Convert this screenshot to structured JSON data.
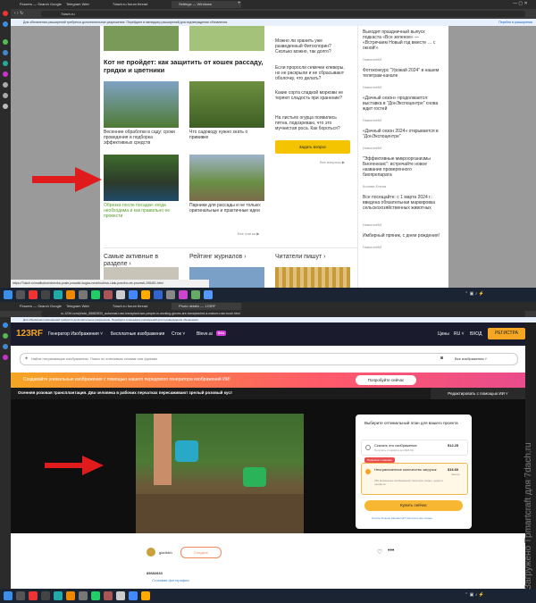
{
  "browser1": {
    "tabs": [
      "Flowers — Search Google",
      "Telegram Web",
      "7dach.ru forum thread",
      "Settings — Windows"
    ],
    "url": "7dach.ru",
    "notice": "Для обновления расширений требуется дополнительное разрешение. Перейдите в менеджер расширений для подтверждения обновления.",
    "notice_btn": "Перейти в расширения"
  },
  "page1": {
    "section_title": "Кот не пройдет: как защитить от кошек рассаду, грядки и цветники",
    "cards": [
      "Весенние обработки в саду: сроки проведения и подборка эффективных средств",
      "Что садоводу нужно знать о прививке",
      "Обрезка после посадки: когда необходима и как правильно ее провести",
      "Парники для рассады и не только: оригинальные и практичные идеи"
    ],
    "all_articles": "Все статьи ▶",
    "qa": [
      "Можно ли хранить уже разведенный Фитоспорин? Сколько можно, так долго?",
      "Если проросли семечки клеверы, но не раскрыли и не сбрасывают оболочку, что делать?",
      "Какие сорта сладкой моркови не теряют сладость при хранении?",
      "На листьях огурца появились пятна, подозреваю, что это мучнистая роса. Как бороться?"
    ],
    "ask_btn": "Задать вопрос",
    "all_questions": "Все вопросы ▶",
    "news": [
      {
        "t": "Выходит праздничный выпуск подкаста «Все зеленое» — «Встречаем Новый год вместе … с окной!»",
        "s": "НовостиНИ"
      },
      {
        "t": "Фотоконкурс \"Урожай 2024\" в нашем телеграм-канале",
        "s": "НовостиНИ"
      },
      {
        "t": "«Дачный сезон» продолжается: выставка в \"ДонЭкспоцентре\" снова ждет гостей",
        "s": "НовостиНИ"
      },
      {
        "t": "«Дачный сезон 2024» открывается в \"ДонЭкспоцентре\"",
        "s": "НовостиНИ"
      },
      {
        "t": "\"Эффективные микроорганизмы Биогенезис\": встречайте новое название проверенного биопрепарата",
        "s": "Колова Елена"
      },
      {
        "t": "Все посещайте: с 1 марта 2024 г.: введена обязательная маркировка сельскохозяйственных животных",
        "s": "НовостиНИ"
      },
      {
        "t": "Имбирный пряник, с днем рождения!",
        "s": "НовостиНИ"
      }
    ],
    "bottom_sections": [
      "Самые активные в разделе ›",
      "Рейтинг журналов ›",
      "Читатели пишут ›"
    ],
    "status_url": "https://7dach.ru/mailkobra/obrezka-posle-posadki-kogda-neobhodima-i-kak-pravilno-ee-provesti-298481.html"
  },
  "browser2": {
    "tabs": [
      "Flowers — Search Google",
      "Telegram Web",
      "7dach.ru forum thread",
      "Photo details — 123RF"
    ],
    "url": "ru.123rf.com/photo_85682833_autumnal-rose-transplant-two-people-in-working-gloves-are-transplanted-a-mature-rose-bush.html",
    "notice": "Для обновления расширений требуется дополнительное разрешение. Перейдите в менеджер расширений для подтверждения обновления."
  },
  "page2": {
    "logo": "123RF",
    "nav": [
      "Генератор Изображения ˅",
      "Бесплатные изображения",
      "Сток ˅",
      "Bleve.ai"
    ],
    "nav_badge": "Beta",
    "right_nav": [
      "Цены",
      "RU ˅",
      "ВХОД"
    ],
    "register": "РЕГИСТРА",
    "search_placeholder": "Найти потрясающие изображения. Поиск по ключевым словам или фразам",
    "search_scope": "Все изображения ˅",
    "promo": "Создавайте уникальные изображения с помощью нашего передового генератора изображений ИИ!",
    "promo_btn": "Попробуйте сейчас",
    "photo_title": "Осенняя розовая трансплантация. Два человека в рабочих перчатках пересаживают зрелый розовый куст",
    "edit_ai": "Редактировать с помощью ИИ ˅",
    "plan_title": "Выберите оптимальный план для вашего проекта",
    "opt1": "Скачать это изображение",
    "opt1_price": "$12.25",
    "opt1_sub": "Получить 2 шрифта для $24.50",
    "opt2_badge": "Подписка с ковение",
    "opt2": "Неограниченное количество загрузок",
    "opt2_price": "$16.60",
    "opt2_per": "/месяц",
    "opt2_sub": "250 возможных изображений, векторов, видео, аудио и шрифтов",
    "buy_btn": "Купить сейчас",
    "more_options": "Хотите больше вариантов? Смотреть все планы",
    "author": "gladkikh",
    "follow": "Следите",
    "photo_id": "85682833",
    "stock_label": "Стоковая фотография"
  },
  "taskbar": {
    "time1": "",
    "time2": ""
  },
  "watermark": "Загружено Tpmartcraft для 7dach.ru",
  "colors": {
    "arrow": "#e01b1b",
    "register": "#f5a623",
    "buy": "#f7b733",
    "ask": "#f5c400",
    "link_green": "#5a9a2a"
  }
}
